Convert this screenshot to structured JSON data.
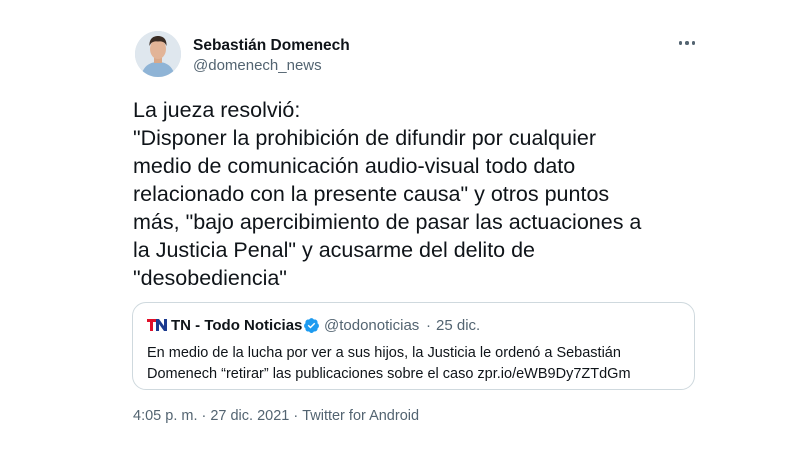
{
  "author": {
    "name": "Sebastián Domenech",
    "handle": "@domenech_news"
  },
  "tweet_lines": [
    "La jueza resolvió:",
    "\"Disponer la prohibición de difundir por cualquier",
    "medio de comunicación audio-visual todo dato",
    "relacionado con la presente causa\" y otros puntos",
    "más, \"bajo apercibimiento de pasar las actuaciones a",
    "la Justicia Penal\" y acusarme del delito de",
    "\"desobediencia\""
  ],
  "quoted": {
    "logo_text": "TN",
    "name": "TN - Todo Noticias",
    "verified": true,
    "handle": "@todonoticias",
    "separator": "·",
    "date": "25 dic.",
    "text_lines": [
      "En medio de la lucha por ver a sus hijos, la Justicia le ordenó a Sebastián",
      "Domenech “retirar” las publicaciones sobre el caso zpr.io/eWB9Dy7ZTdGm"
    ]
  },
  "meta": {
    "time": "4:05 p. m.",
    "date": "27 dic. 2021",
    "separator": "·",
    "source": "Twitter for Android"
  },
  "colors": {
    "text": "#0f1419",
    "secondary": "#536471",
    "border": "#cfd9de",
    "verified": "#1d9bf0",
    "tn_red": "#e0102a",
    "tn_blue": "#1b3a8f"
  },
  "icons": {
    "more": "more-horizontal-icon",
    "verified": "verified-badge-icon",
    "tn_logo": "tn-logo-icon"
  }
}
